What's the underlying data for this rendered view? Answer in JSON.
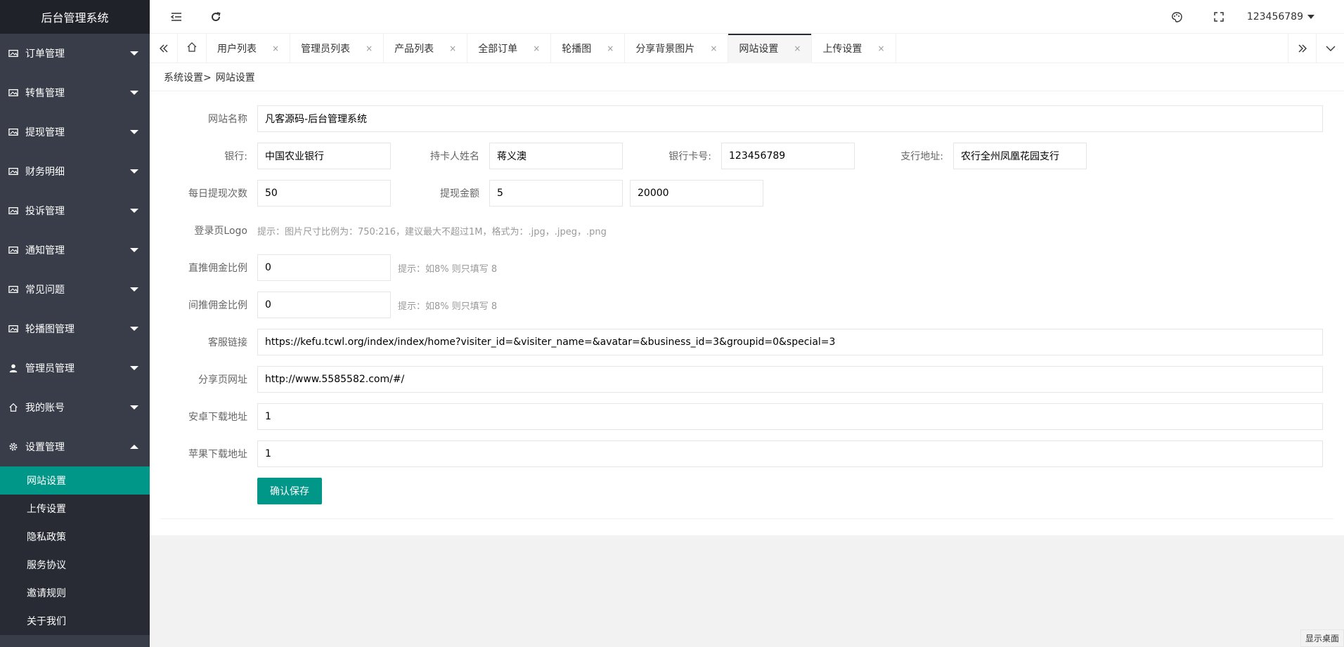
{
  "app": {
    "title": "后台管理系统"
  },
  "sidebar": {
    "items": [
      {
        "label": "订单管理",
        "icon": "image-icon"
      },
      {
        "label": "转售管理",
        "icon": "image-icon"
      },
      {
        "label": "提现管理",
        "icon": "image-icon"
      },
      {
        "label": "财务明细",
        "icon": "image-icon"
      },
      {
        "label": "投诉管理",
        "icon": "image-icon"
      },
      {
        "label": "通知管理",
        "icon": "image-icon"
      },
      {
        "label": "常见问题",
        "icon": "image-icon"
      },
      {
        "label": "轮播图管理",
        "icon": "image-icon"
      },
      {
        "label": "管理员管理",
        "icon": "user-icon"
      },
      {
        "label": "我的账号",
        "icon": "home-icon"
      },
      {
        "label": "设置管理",
        "icon": "gear-icon"
      }
    ],
    "sub_items": [
      "网站设置",
      "上传设置",
      "隐私政策",
      "服务协议",
      "邀请规则",
      "关于我们"
    ]
  },
  "header": {
    "user": "123456789"
  },
  "tabs": [
    {
      "label": "用户列表"
    },
    {
      "label": "管理员列表"
    },
    {
      "label": "产品列表"
    },
    {
      "label": "全部订单"
    },
    {
      "label": "轮播图"
    },
    {
      "label": "分享背景图片"
    },
    {
      "label": "网站设置"
    },
    {
      "label": "上传设置"
    }
  ],
  "close_glyph": "×",
  "breadcrumb": {
    "parent": "系统设置>",
    "current": "网站设置"
  },
  "form": {
    "site_name": {
      "label": "网站名称",
      "value": "凡客源码-后台管理系统"
    },
    "bank": {
      "label": "银行:",
      "value": "中国农业银行"
    },
    "holder": {
      "label": "持卡人姓名",
      "value": "蒋义澳"
    },
    "card_no": {
      "label": "银行卡号:",
      "value": "123456789"
    },
    "branch": {
      "label": "支行地址:",
      "value": "农行全州凤凰花园支行"
    },
    "daily_times": {
      "label": "每日提现次数",
      "value": "50"
    },
    "withdraw_amount": {
      "label": "提现金额",
      "min": "5",
      "max": "20000"
    },
    "login_logo": {
      "label": "登录页Logo",
      "hint": "提示：图片尺寸比例为：750:216，建议最大不超过1M，格式为：.jpg，.jpeg，.png"
    },
    "direct_ratio": {
      "label": "直推佣金比例",
      "value": "0",
      "hint": "提示：如8% 则只填写 8"
    },
    "indirect_ratio": {
      "label": "间推佣金比例",
      "value": "0",
      "hint": "提示：如8% 则只填写 8"
    },
    "service_link": {
      "label": "客服链接",
      "value": "https://kefu.tcwl.org/index/index/home?visiter_id=&visiter_name=&avatar=&business_id=3&groupid=0&special=3"
    },
    "share_url": {
      "label": "分享页网址",
      "value": "http://www.5585582.com/#/"
    },
    "android_url": {
      "label": "安卓下载地址",
      "value": "1"
    },
    "ios_url": {
      "label": "苹果下载地址",
      "value": "1"
    },
    "save_label": "确认保存"
  },
  "footer": {
    "show_desktop": "显示桌面"
  },
  "colors": {
    "sidebar": "#393D49",
    "logo_bg": "#20222A",
    "accent": "#009688",
    "sub_bg": "#282B33"
  }
}
